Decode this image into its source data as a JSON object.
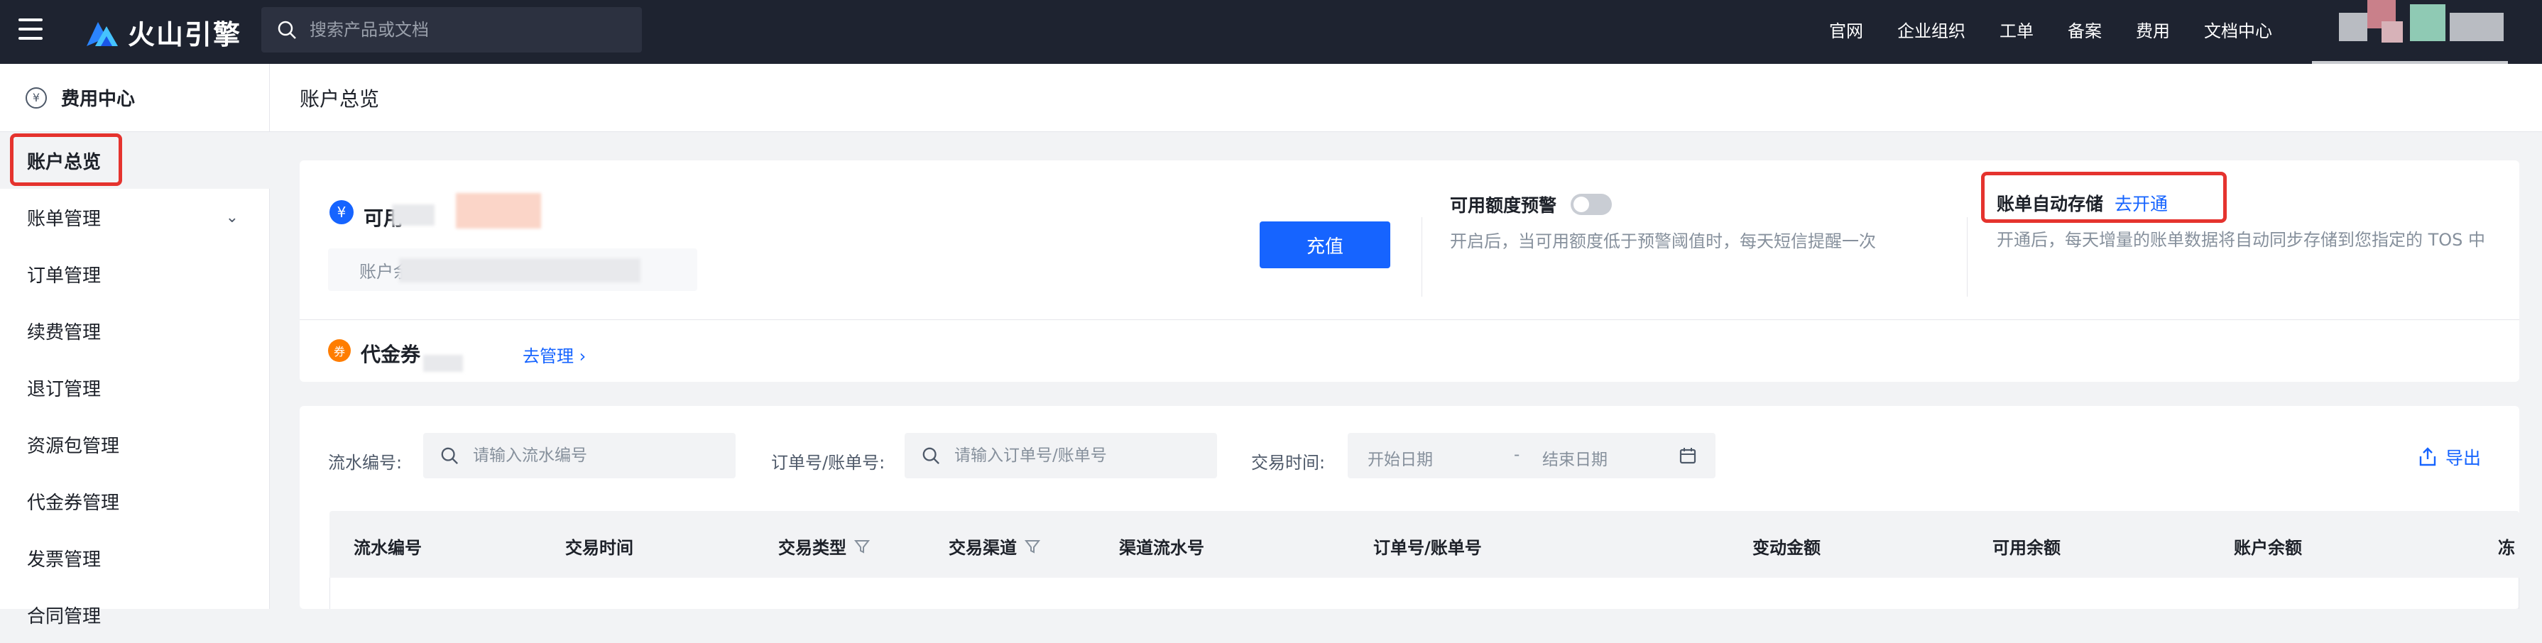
{
  "topbar": {
    "brand": "火山引擎",
    "search_placeholder": "搜索产品或文档",
    "nav": [
      "官网",
      "企业组织",
      "工单",
      "备案",
      "费用",
      "文档中心"
    ]
  },
  "sidebar": {
    "header": "费用中心",
    "items": [
      {
        "label": "账户总览"
      },
      {
        "label": "账单管理"
      },
      {
        "label": "订单管理"
      },
      {
        "label": "续费管理"
      },
      {
        "label": "退订管理"
      },
      {
        "label": "资源包管理"
      },
      {
        "label": "代金券管理"
      },
      {
        "label": "发票管理"
      },
      {
        "label": "合同管理"
      }
    ]
  },
  "page": {
    "title": "账户总览"
  },
  "balance": {
    "available_label": "可用",
    "account_balance_label": "账户余",
    "recharge_label": "充值"
  },
  "alert": {
    "title": "可用额度预警",
    "desc": "开启后，当可用额度低于预警阈值时，每天短信提醒一次"
  },
  "storage": {
    "title": "账单自动存储",
    "link": "去开通",
    "desc": "开通后，每天增量的账单数据将自动同步存储到您指定的 TOS 中"
  },
  "coupon": {
    "label": "代金券",
    "link": "去管理"
  },
  "filters": {
    "serial_label": "流水编号:",
    "serial_placeholder": "请输入流水编号",
    "order_label": "订单号/账单号:",
    "order_placeholder": "请输入订单号/账单号",
    "time_label": "交易时间:",
    "start_placeholder": "开始日期",
    "sep": "-",
    "end_placeholder": "结束日期",
    "export_label": "导出"
  },
  "table": {
    "columns": [
      "流水编号",
      "交易时间",
      "交易类型",
      "交易渠道",
      "渠道流水号",
      "订单号/账单号",
      "变动金额",
      "可用余额",
      "账户余额",
      "冻"
    ]
  },
  "colors": {
    "primary": "#1664ff",
    "topbar": "#1e2330",
    "highlight": "#e5332e"
  }
}
